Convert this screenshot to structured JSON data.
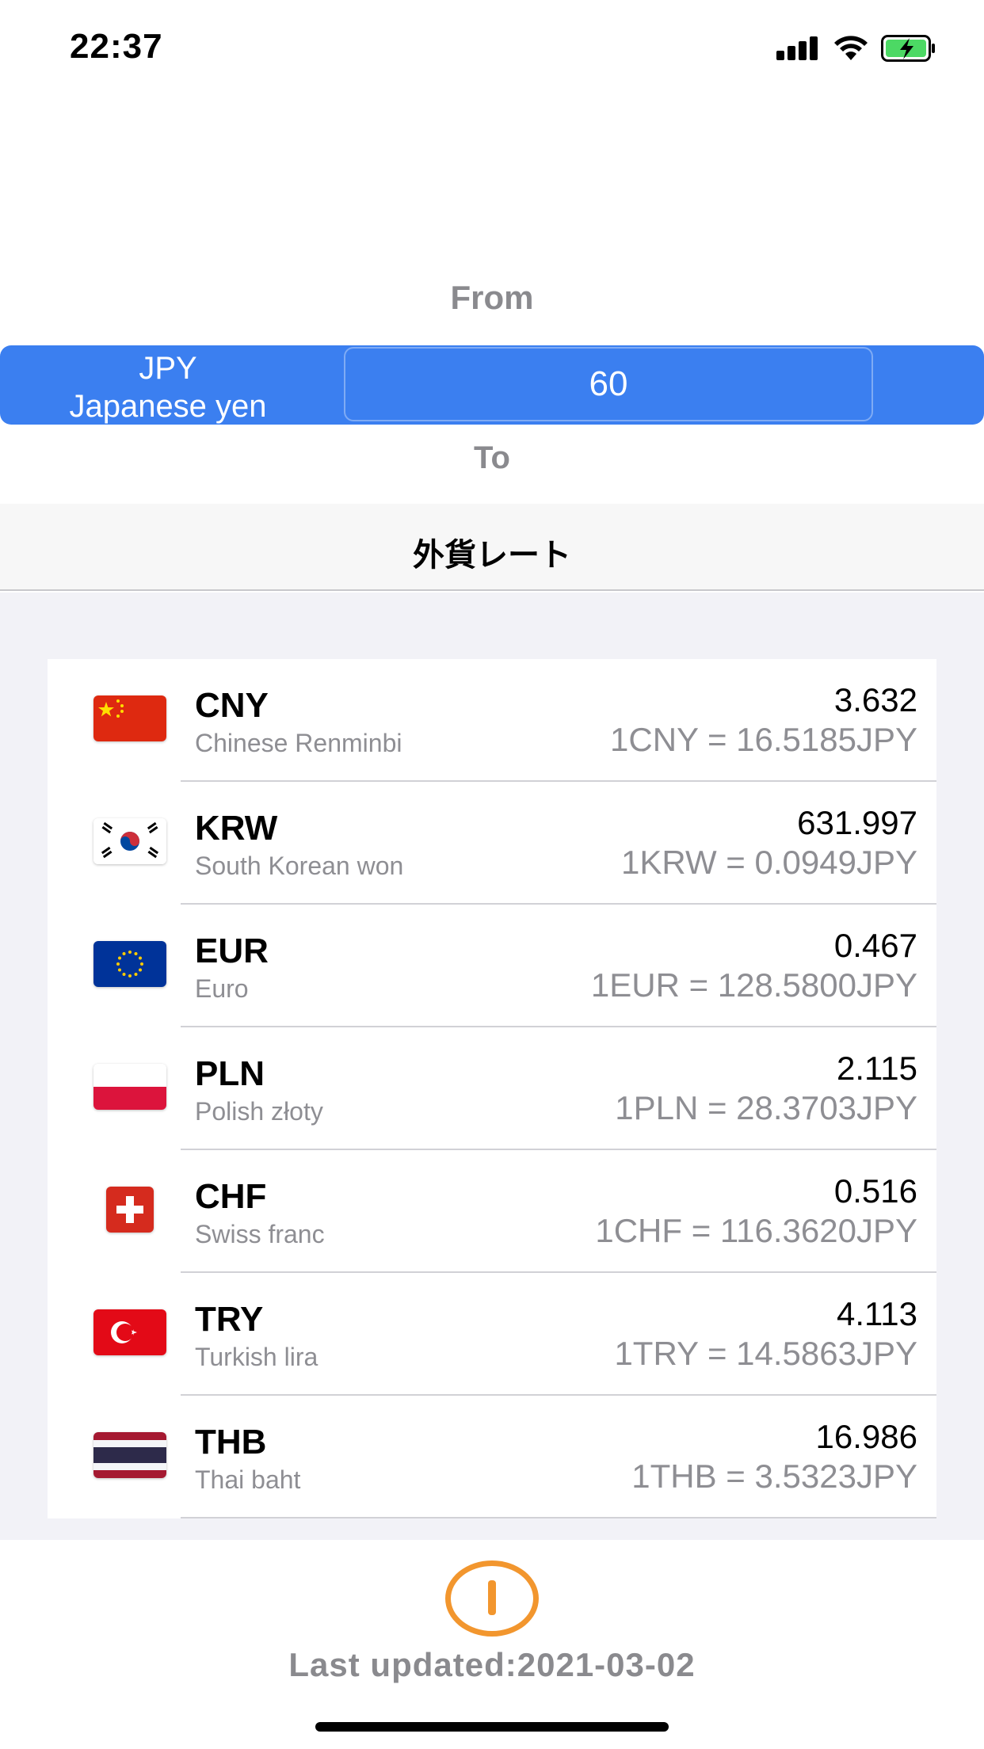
{
  "status_bar": {
    "time": "22:37"
  },
  "converter": {
    "from_label": "From",
    "currency_code": "JPY",
    "currency_name": "Japanese yen",
    "amount": "60",
    "to_label": "To"
  },
  "section": {
    "title": "外貨レート"
  },
  "rates": [
    {
      "code": "CNY",
      "name": "Chinese Renminbi",
      "value": "3.632",
      "rate": "1CNY = 16.5185JPY",
      "flag": "china-flag-icon"
    },
    {
      "code": "KRW",
      "name": "South Korean won",
      "value": "631.997",
      "rate": "1KRW = 0.0949JPY",
      "flag": "south-korea-flag-icon"
    },
    {
      "code": "EUR",
      "name": "Euro",
      "value": "0.467",
      "rate": "1EUR = 128.5800JPY",
      "flag": "eu-flag-icon"
    },
    {
      "code": "PLN",
      "name": "Polish złoty",
      "value": "2.115",
      "rate": "1PLN = 28.3703JPY",
      "flag": "poland-flag-icon"
    },
    {
      "code": "CHF",
      "name": "Swiss franc",
      "value": "0.516",
      "rate": "1CHF = 116.3620JPY",
      "flag": "switzerland-flag-icon"
    },
    {
      "code": "TRY",
      "name": "Turkish lira",
      "value": "4.113",
      "rate": "1TRY = 14.5863JPY",
      "flag": "turkey-flag-icon"
    },
    {
      "code": "THB",
      "name": "Thai baht",
      "value": "16.986",
      "rate": "1THB = 3.5323JPY",
      "flag": "thailand-flag-icon"
    }
  ],
  "footer": {
    "last_updated": "Last updated:2021-03-02",
    "info_icon": "info-icon"
  },
  "colors": {
    "accent": "#3b7ff0",
    "info": "#f2962e",
    "battery": "#4cd964"
  }
}
